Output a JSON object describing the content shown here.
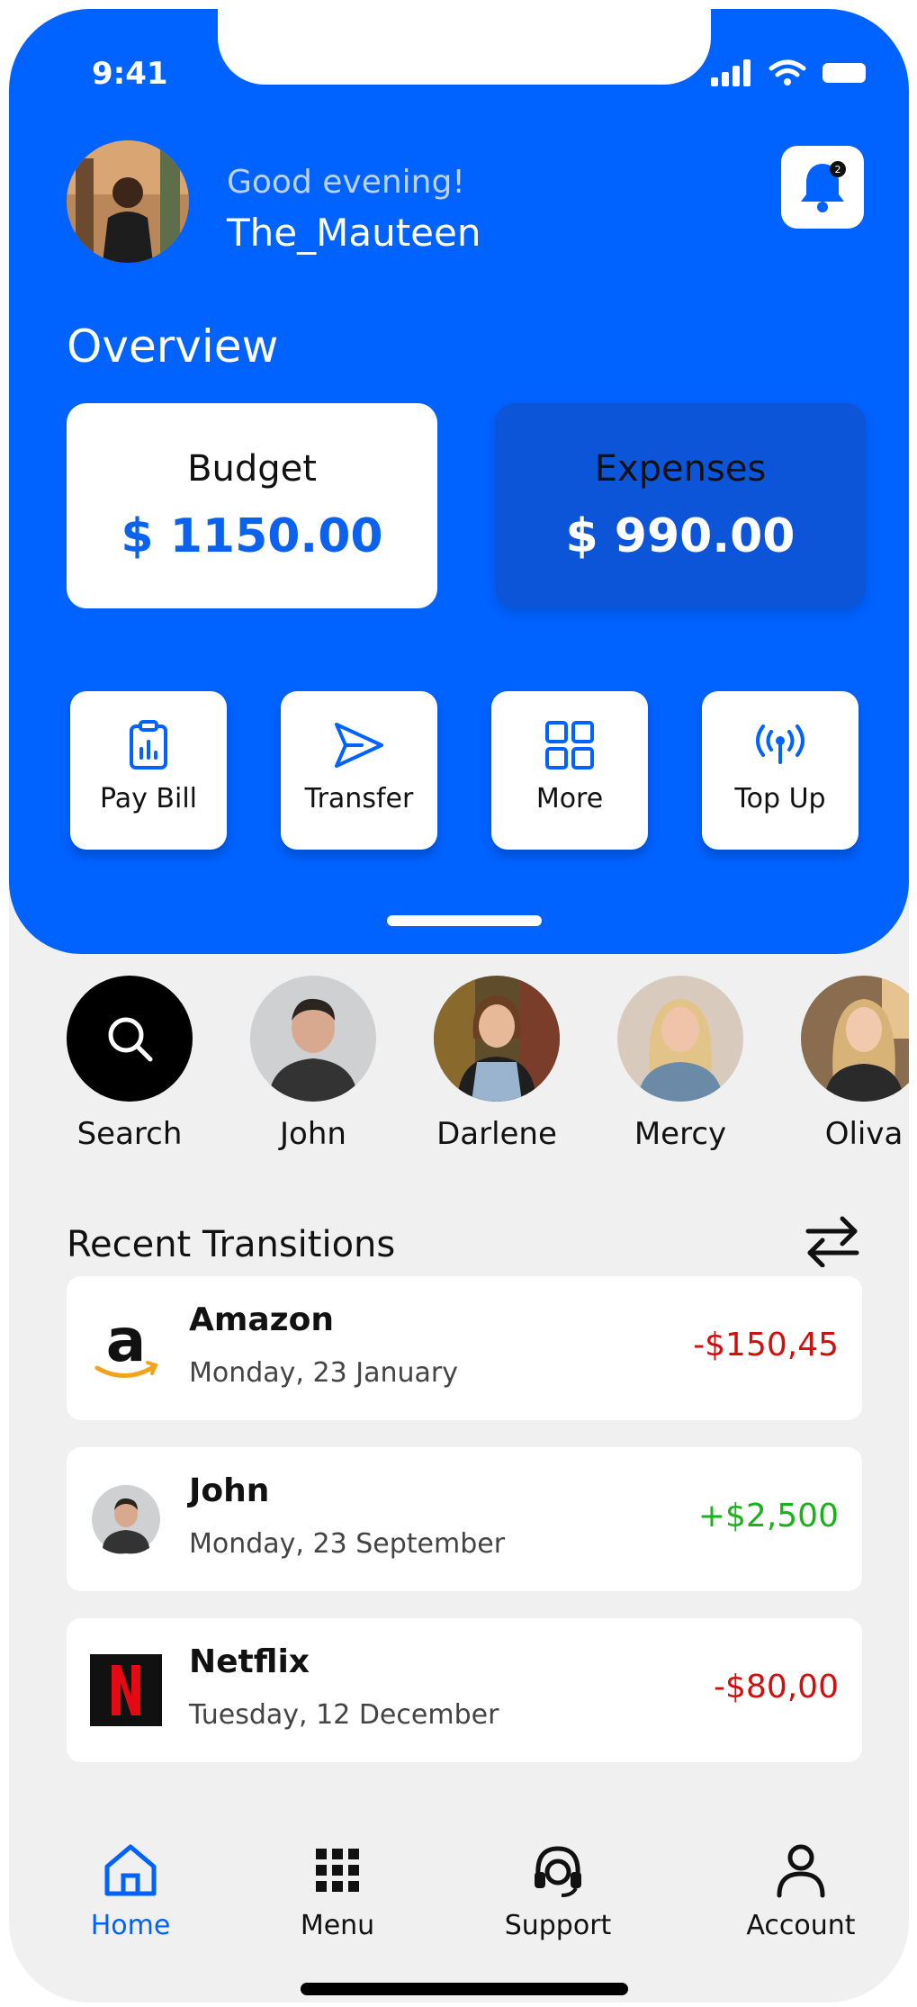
{
  "status": {
    "time": "9:41"
  },
  "header": {
    "greeting": "Good evening!",
    "username": "The_Mauteen",
    "notification_count": "2"
  },
  "overview": {
    "title": "Overview",
    "budget": {
      "label": "Budget",
      "value": "$ 1150.00"
    },
    "expenses": {
      "label": "Expenses",
      "value": "$ 990.00"
    }
  },
  "actions": [
    {
      "label": "Pay Bill",
      "icon": "clipboard-icon"
    },
    {
      "label": "Transfer",
      "icon": "send-icon"
    },
    {
      "label": "More",
      "icon": "grid-icon"
    },
    {
      "label": "Top Up",
      "icon": "signal-icon"
    }
  ],
  "contacts": [
    {
      "label": "Search",
      "icon": "search-icon"
    },
    {
      "label": "John"
    },
    {
      "label": "Darlene"
    },
    {
      "label": "Mercy"
    },
    {
      "label": "Oliva"
    }
  ],
  "recent": {
    "title": "Recent Transitions",
    "items": [
      {
        "name": "Amazon",
        "date": "Monday, 23 January",
        "amount": "-$150,45",
        "logo": "amazon-logo"
      },
      {
        "name": "John",
        "date": "Monday, 23 September",
        "amount": "+$2,500",
        "logo": "avatar"
      },
      {
        "name": "Netflix",
        "date": "Tuesday, 12 December",
        "amount": "-$80,00",
        "logo": "netflix-logo"
      }
    ]
  },
  "nav": [
    {
      "label": "Home",
      "icon": "home-icon",
      "active": true
    },
    {
      "label": "Menu",
      "icon": "menu-grid-icon"
    },
    {
      "label": "Support",
      "icon": "headset-icon"
    },
    {
      "label": "Account",
      "icon": "user-icon"
    }
  ],
  "colors": {
    "primary": "#0062ff",
    "expense_card": "#0d55d8",
    "negative": "#d20f0f",
    "positive": "#1ab21a"
  }
}
